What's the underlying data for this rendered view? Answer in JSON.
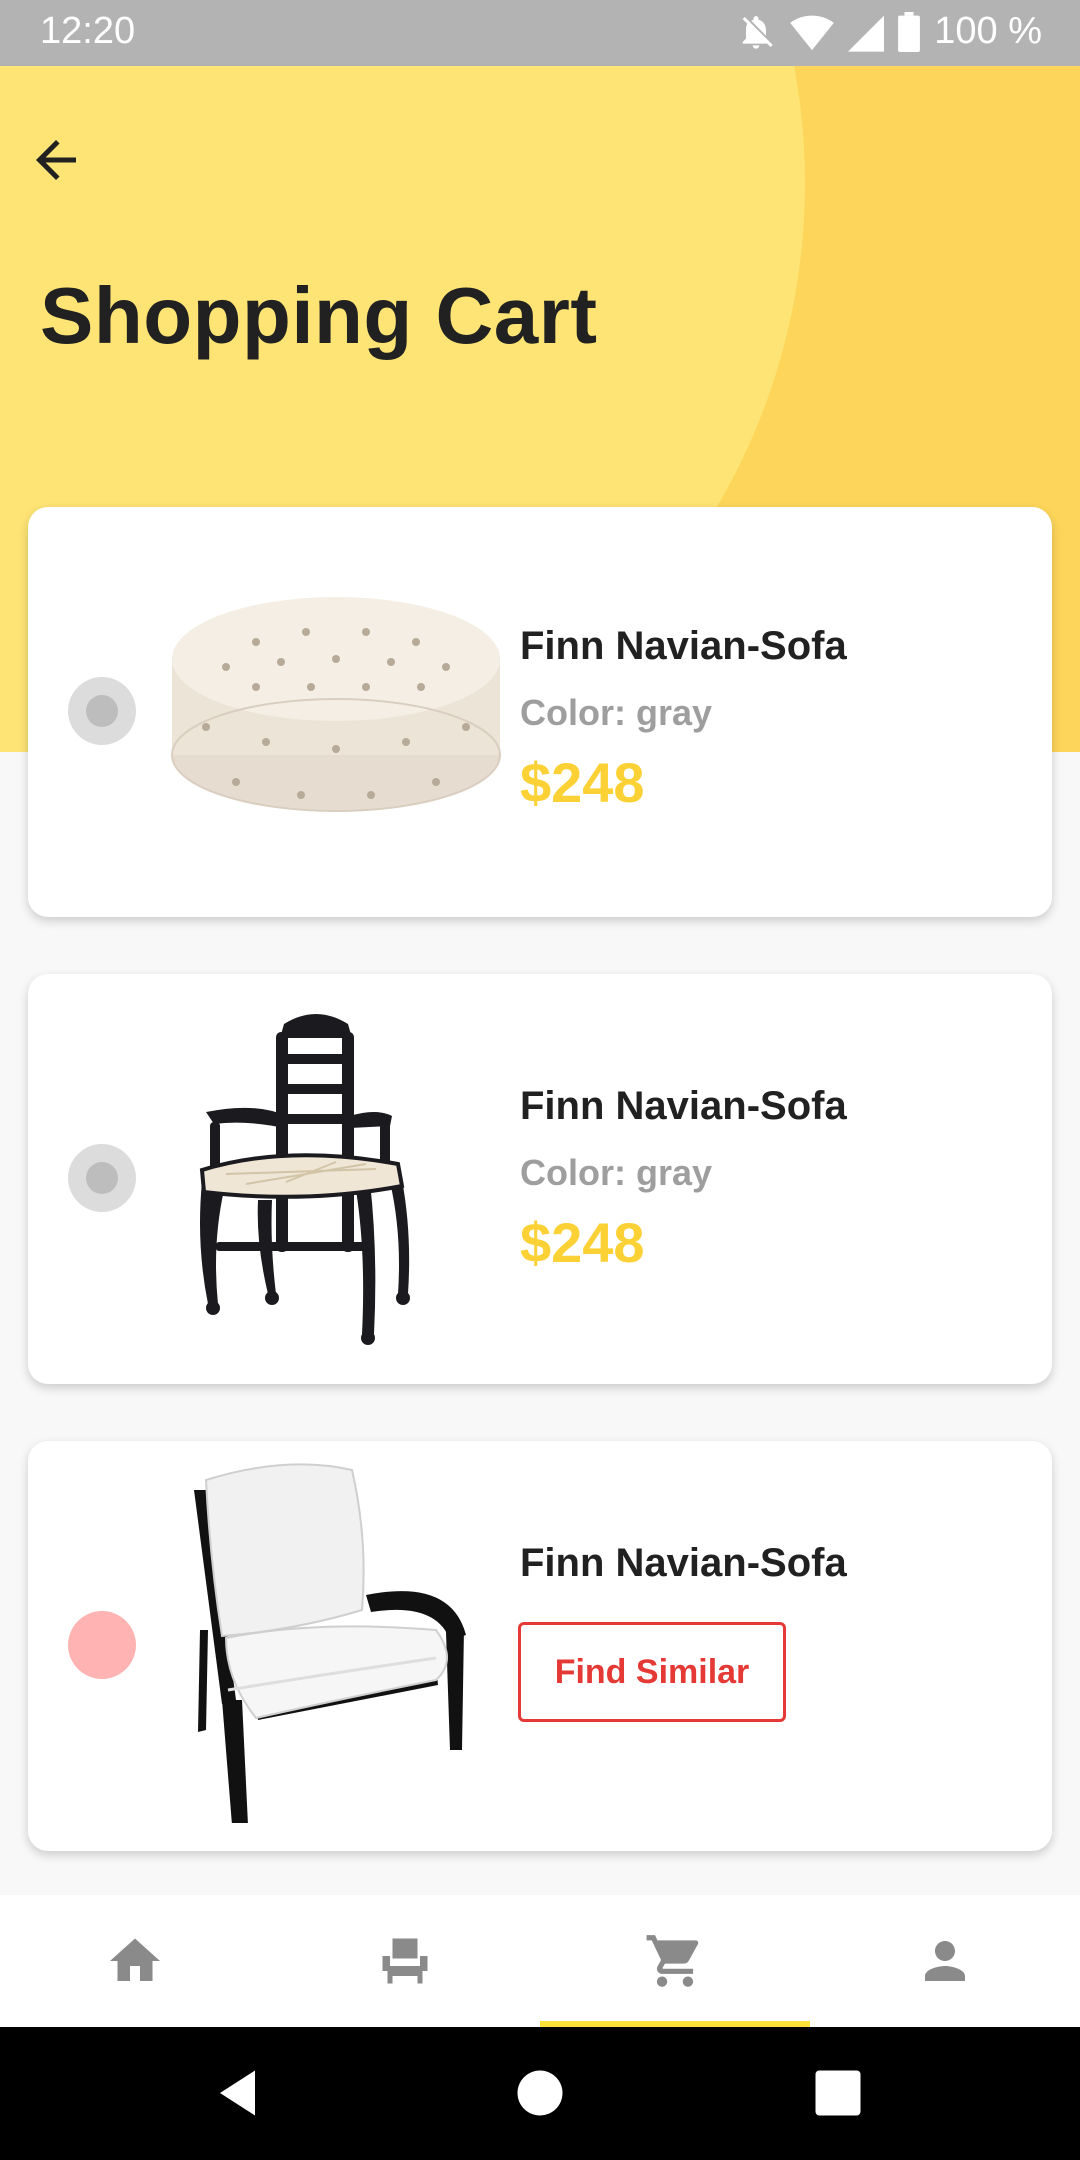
{
  "status_bar": {
    "time": "12:20",
    "battery": "100 %"
  },
  "header": {
    "title": "Shopping Cart"
  },
  "cart_items": [
    {
      "name": "Finn Navian-Sofa",
      "color": "Color: gray",
      "price": "$248",
      "image": "tufted-ottoman-image",
      "available": true
    },
    {
      "name": "Finn Navian-Sofa",
      "color": "Color: gray",
      "price": "$248",
      "image": "dining-chair-image",
      "available": true
    },
    {
      "name": "Finn Navian-Sofa",
      "action_label": "Find Similar",
      "image": "armchair-image",
      "available": false
    }
  ],
  "bottom_nav": {
    "items": [
      "home-icon",
      "chair-icon",
      "cart-icon",
      "person-icon"
    ],
    "active": "cart-icon"
  },
  "colors": {
    "accent": "#fcd136",
    "header_yellow": "#fcd55a",
    "warning_red": "#e53935"
  }
}
